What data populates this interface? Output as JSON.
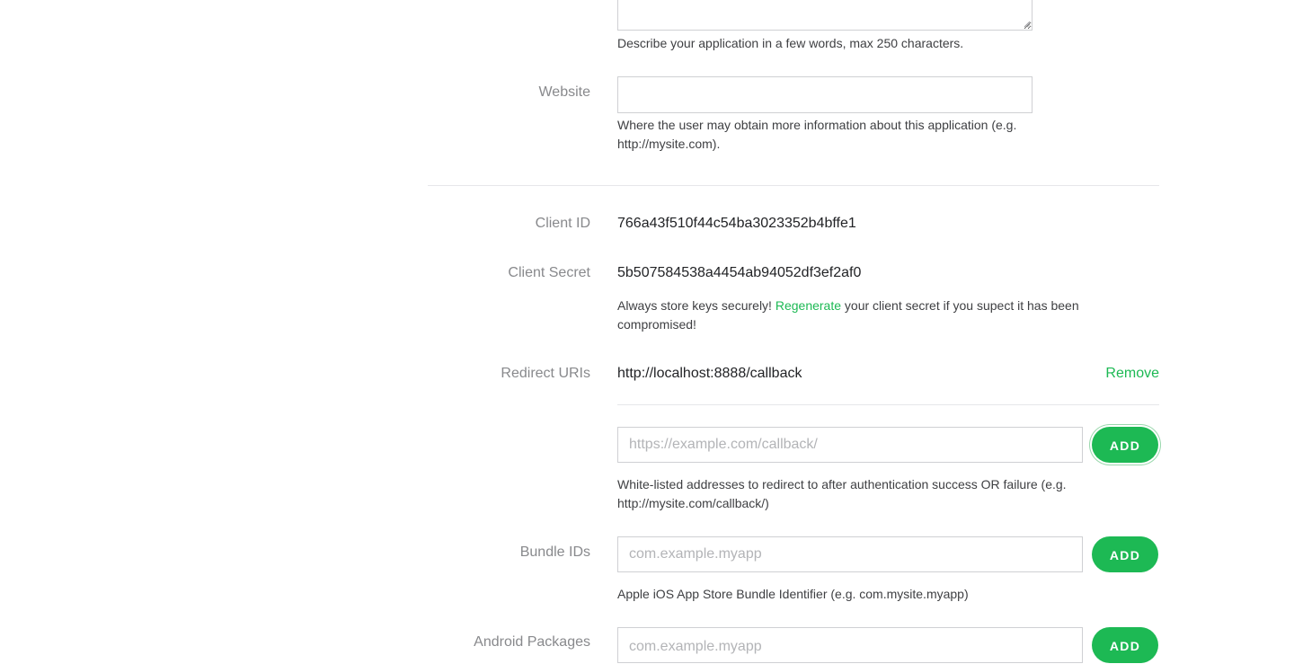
{
  "description": {
    "help": "Describe your application in a few words, max 250 characters."
  },
  "website": {
    "label": "Website",
    "value": "",
    "help": "Where the user may obtain more information about this application (e.g. http://mysite.com)."
  },
  "client_id": {
    "label": "Client ID",
    "value": "766a43f510f44c54ba3023352b4bffe1"
  },
  "client_secret": {
    "label": "Client Secret",
    "value": "5b507584538a4454ab94052df3ef2af0",
    "help_prefix": "Always store keys securely! ",
    "help_link": "Regenerate",
    "help_suffix": " your client secret if you supect it has been compromised!"
  },
  "redirect_uris": {
    "label": "Redirect URIs",
    "items": [
      "http://localhost:8888/callback"
    ],
    "remove_label": "Remove",
    "placeholder": "https://example.com/callback/",
    "add_label": "ADD",
    "help": "White-listed addresses to redirect to after authentication success OR failure (e.g. http://mysite.com/callback/)"
  },
  "bundle_ids": {
    "label": "Bundle IDs",
    "placeholder": "com.example.myapp",
    "add_label": "ADD",
    "help": "Apple iOS App Store Bundle Identifier (e.g. com.mysite.myapp)"
  },
  "android_packages": {
    "label": "Android Packages",
    "placeholder": "com.example.myapp",
    "add_label": "ADD"
  },
  "colors": {
    "accent": "#1db954",
    "label": "#88898c",
    "text": "#222326",
    "border": "#cfd0d3",
    "divider": "#e6e7ea"
  }
}
